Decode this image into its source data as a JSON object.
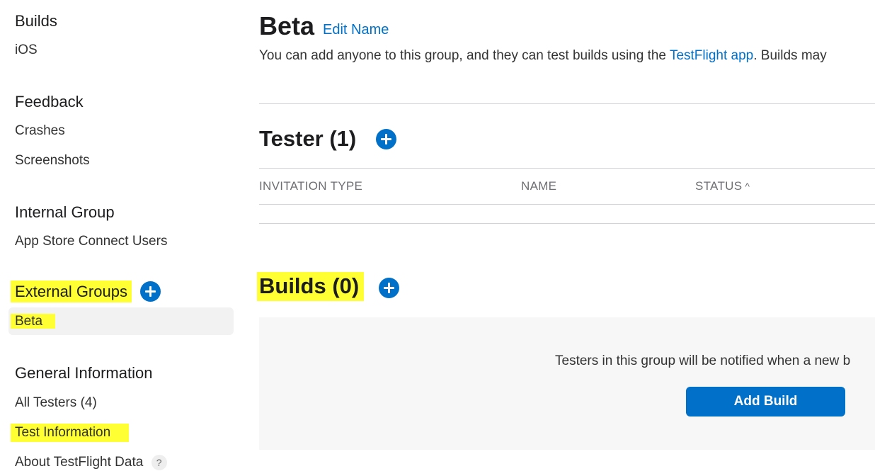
{
  "sidebar": {
    "builds": {
      "title": "Builds",
      "items": [
        "iOS"
      ]
    },
    "feedback": {
      "title": "Feedback",
      "items": [
        "Crashes",
        "Screenshots"
      ]
    },
    "internal": {
      "title": "Internal Group",
      "items": [
        "App Store Connect Users"
      ]
    },
    "external": {
      "title": "External Groups",
      "add_icon": "plus-circle-icon",
      "items": [
        "Beta"
      ]
    },
    "general": {
      "title": "General Information",
      "items": [
        "All Testers (4)",
        "Test Information",
        "About TestFlight Data"
      ],
      "help_icon": "question-mark-icon",
      "help_glyph": "?"
    }
  },
  "main": {
    "group_title": "Beta",
    "edit_name": "Edit Name",
    "description_pre": "You can add anyone to this group, and they can test builds using the ",
    "description_link": "TestFlight app",
    "description_post": ". Builds may",
    "testers": {
      "title": "Tester (1)",
      "columns": [
        "INVITATION TYPE",
        "NAME",
        "STATUS"
      ],
      "sort_glyph": "^"
    },
    "builds": {
      "title": "Builds (0)",
      "empty_text": "Testers in this group will be notified when a new b",
      "add_button": "Add Build"
    }
  },
  "colors": {
    "accent": "#0070c9",
    "highlight": "#ffff33"
  }
}
